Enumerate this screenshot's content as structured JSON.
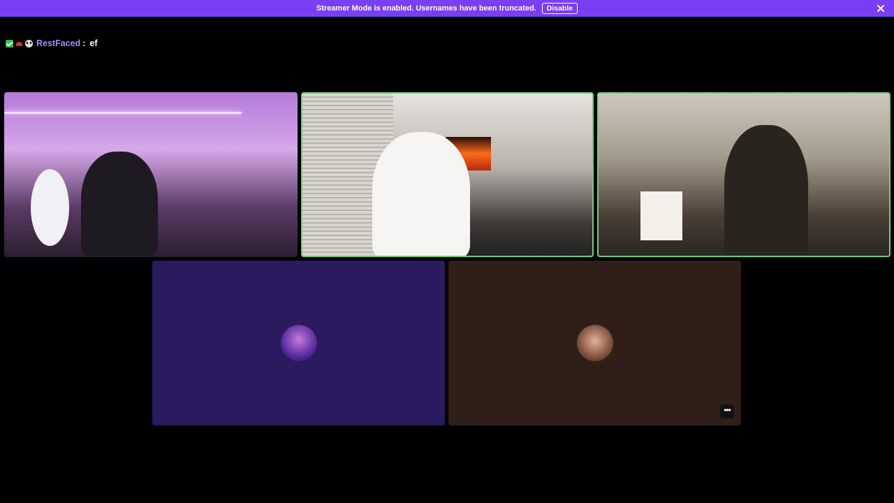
{
  "banner": {
    "message": "Streamer Mode is enabled. Usernames have been truncated.",
    "disable_label": "Disable",
    "color": "#7a3ff2"
  },
  "chat": {
    "badges": [
      "verified-check-icon",
      "hat-icon",
      "skull-icon"
    ],
    "username": "RestFaced",
    "separator": ":",
    "message": "ef"
  },
  "tiles": [
    {
      "kind": "video",
      "speaking": false
    },
    {
      "kind": "video",
      "speaking": true
    },
    {
      "kind": "video",
      "speaking": true
    },
    {
      "kind": "avatar",
      "background": "#2a1a5e"
    },
    {
      "kind": "avatar",
      "background": "#2f1f18",
      "menu_icon": "more-options-icon"
    }
  ]
}
